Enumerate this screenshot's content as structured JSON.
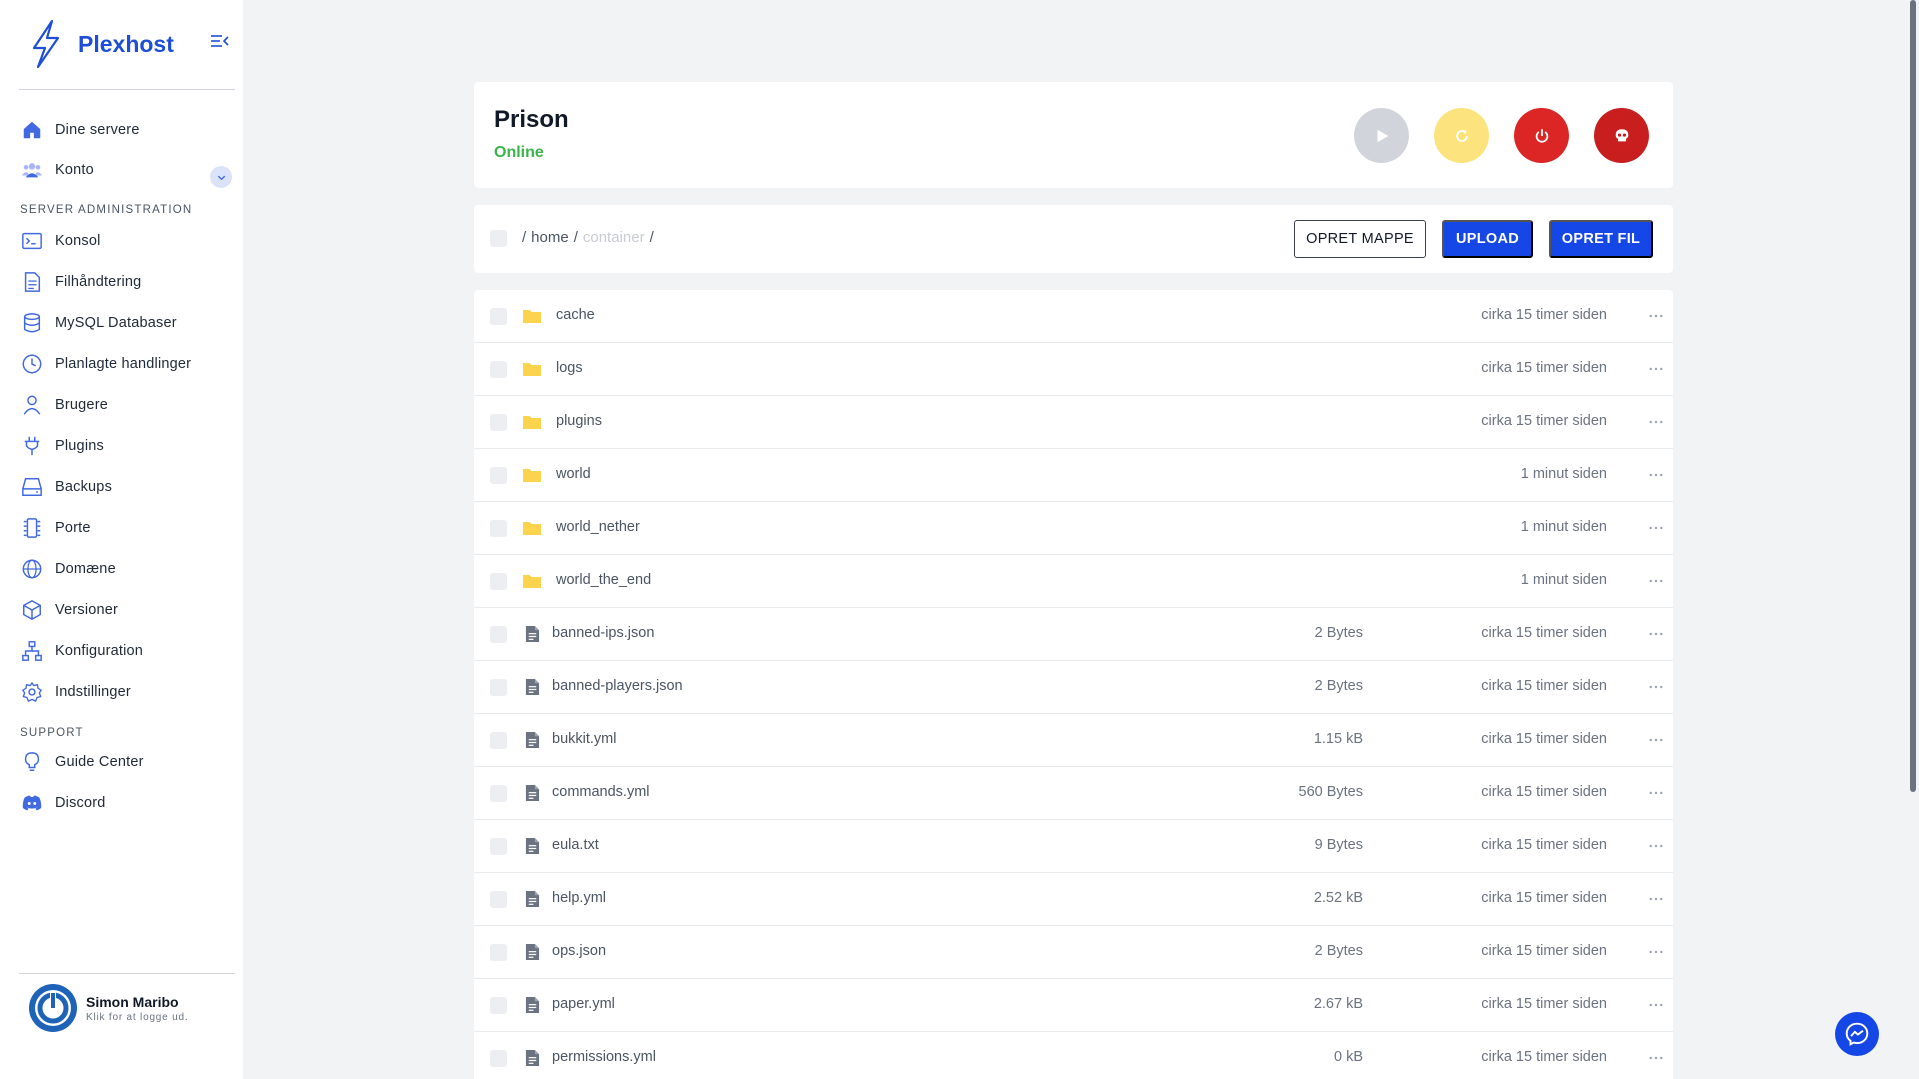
{
  "brand": {
    "name": "Plexhost"
  },
  "nav": {
    "top_items": [
      {
        "label": "Dine servere",
        "icon": "home-icon"
      },
      {
        "label": "Konto",
        "icon": "users-icon"
      }
    ],
    "section_admin": "SERVER ADMINISTRATION",
    "admin_items": [
      {
        "label": "Konsol",
        "icon": "terminal-icon"
      },
      {
        "label": "Filhåndtering",
        "icon": "document-icon"
      },
      {
        "label": "MySQL Databaser",
        "icon": "database-icon"
      },
      {
        "label": "Planlagte handlinger",
        "icon": "clock-icon"
      },
      {
        "label": "Brugere",
        "icon": "user-icon"
      },
      {
        "label": "Plugins",
        "icon": "plug-icon"
      },
      {
        "label": "Backups",
        "icon": "hard-drive-icon"
      },
      {
        "label": "Porte",
        "icon": "port-icon"
      },
      {
        "label": "Domæne",
        "icon": "globe-icon"
      },
      {
        "label": "Versioner",
        "icon": "cube-icon"
      },
      {
        "label": "Konfiguration",
        "icon": "sitemap-icon"
      },
      {
        "label": "Indstillinger",
        "icon": "gear-icon"
      }
    ],
    "section_support": "SUPPORT",
    "support_items": [
      {
        "label": "Guide Center",
        "icon": "lightbulb-icon"
      },
      {
        "label": "Discord",
        "icon": "discord-icon"
      }
    ]
  },
  "user": {
    "name": "Simon Maribo",
    "subtitle": "Klik for at logge ud."
  },
  "server": {
    "name": "Prison",
    "status": "Online"
  },
  "breadcrumb": {
    "sep1": "/",
    "home": "home",
    "sep2": "/",
    "current": "container",
    "sep3": "/"
  },
  "actions": {
    "create_folder": "OPRET MAPPE",
    "upload": "UPLOAD",
    "create_file": "OPRET FIL"
  },
  "files": [
    {
      "name": "cache",
      "type": "folder",
      "size": "",
      "modified": "cirka 15 timer siden"
    },
    {
      "name": "logs",
      "type": "folder",
      "size": "",
      "modified": "cirka 15 timer siden"
    },
    {
      "name": "plugins",
      "type": "folder",
      "size": "",
      "modified": "cirka 15 timer siden"
    },
    {
      "name": "world",
      "type": "folder",
      "size": "",
      "modified": "1 minut siden"
    },
    {
      "name": "world_nether",
      "type": "folder",
      "size": "",
      "modified": "1 minut siden"
    },
    {
      "name": "world_the_end",
      "type": "folder",
      "size": "",
      "modified": "1 minut siden"
    },
    {
      "name": "banned-ips.json",
      "type": "file",
      "size": "2 Bytes",
      "modified": "cirka 15 timer siden"
    },
    {
      "name": "banned-players.json",
      "type": "file",
      "size": "2 Bytes",
      "modified": "cirka 15 timer siden"
    },
    {
      "name": "bukkit.yml",
      "type": "file",
      "size": "1.15 kB",
      "modified": "cirka 15 timer siden"
    },
    {
      "name": "commands.yml",
      "type": "file",
      "size": "560 Bytes",
      "modified": "cirka 15 timer siden"
    },
    {
      "name": "eula.txt",
      "type": "file",
      "size": "9 Bytes",
      "modified": "cirka 15 timer siden"
    },
    {
      "name": "help.yml",
      "type": "file",
      "size": "2.52 kB",
      "modified": "cirka 15 timer siden"
    },
    {
      "name": "ops.json",
      "type": "file",
      "size": "2 Bytes",
      "modified": "cirka 15 timer siden"
    },
    {
      "name": "paper.yml",
      "type": "file",
      "size": "2.67 kB",
      "modified": "cirka 15 timer siden"
    },
    {
      "name": "permissions.yml",
      "type": "file",
      "size": "0 kB",
      "modified": "cirka 15 timer siden"
    }
  ],
  "colors": {
    "accent": "#1447e6",
    "online": "#3ab54a",
    "folder": "#fcd34d",
    "danger": "#dc2626",
    "warning": "#fce37e"
  }
}
